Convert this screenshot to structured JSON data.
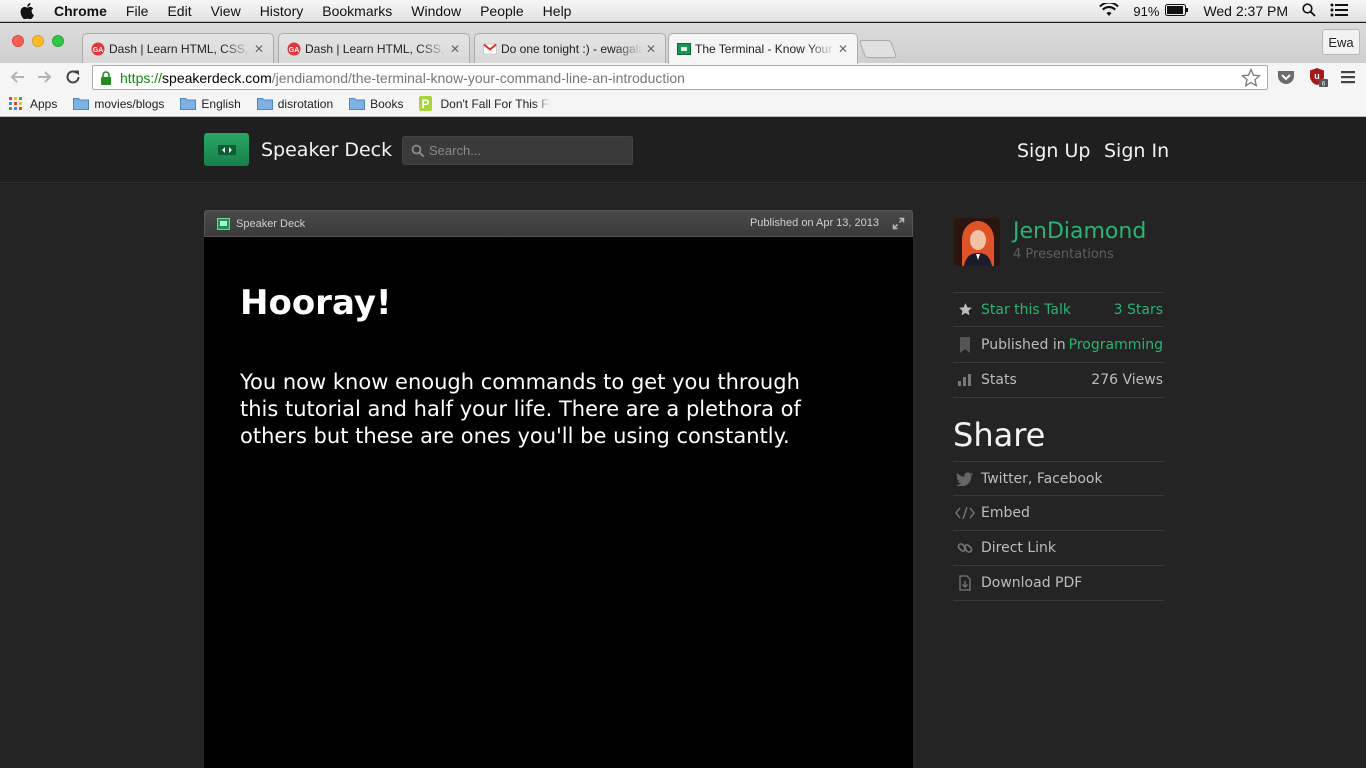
{
  "menubar": {
    "items": [
      "Chrome",
      "File",
      "Edit",
      "View",
      "History",
      "Bookmarks",
      "Window",
      "People",
      "Help"
    ],
    "battery": "91%",
    "clock": "Wed 2:37 PM"
  },
  "tabs": [
    {
      "title": "Dash | Learn HTML, CSS, and",
      "favicon": "ga-icon"
    },
    {
      "title": "Dash | Learn HTML, CSS, and",
      "favicon": "ga-icon"
    },
    {
      "title": "Do one tonight :) - ewagala",
      "favicon": "gmail-icon"
    },
    {
      "title": "The Terminal - Know Your Command Line",
      "favicon": "speakerdeck-icon"
    }
  ],
  "profile_name": "Ewa",
  "url": {
    "scheme": "https://",
    "host": "speakerdeck.com",
    "path": "/jendiamond/the-terminal-know-your-command-line-an-introduction"
  },
  "bookmarks": [
    "Apps",
    "movies/blogs",
    "English",
    "disrotation",
    "Books",
    "Don't Fall For This Fl"
  ],
  "site": {
    "brand": "Speaker Deck",
    "search_placeholder": "Search...",
    "signup": "Sign Up",
    "signin": "Sign In"
  },
  "player": {
    "brand": "Speaker Deck",
    "published": "Published on Apr 13, 2013"
  },
  "slide": {
    "title": "Hooray!",
    "body": "You now know enough commands to get you through this tutorial and half your life. There are a plethora of others but these are ones you'll be using constantly."
  },
  "sidebar": {
    "author": "JenDiamond",
    "presentations": "4 Presentations",
    "star_label": "Star this Talk",
    "star_count": "3 Stars",
    "published_label": "Published in",
    "published_category": "Programming",
    "stats_label": "Stats",
    "stats_value": "276 Views",
    "share_heading": "Share",
    "share_items": [
      "Twitter, Facebook",
      "Embed",
      "Direct Link",
      "Download PDF"
    ]
  },
  "colors": {
    "accent_green": "#2bb371",
    "page_bg": "#242424",
    "header_bg": "#1f1f1f"
  }
}
